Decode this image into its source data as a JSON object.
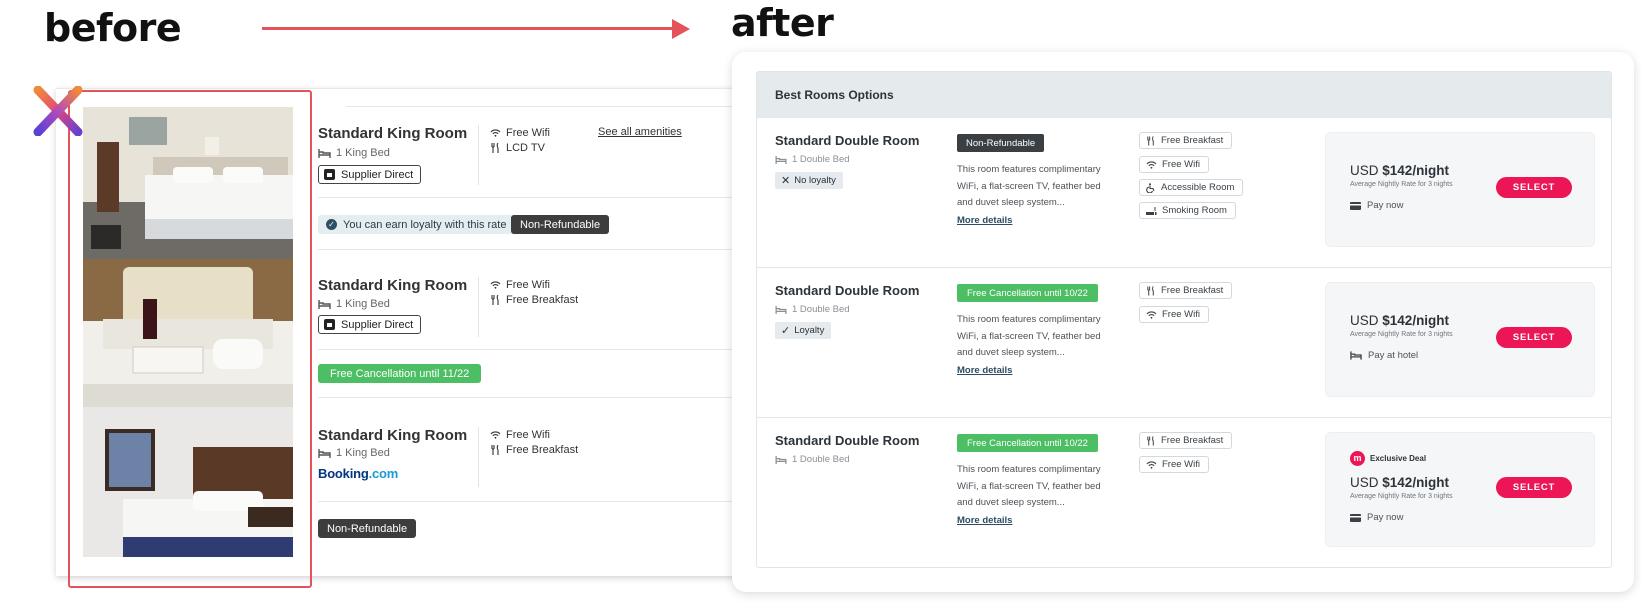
{
  "labels": {
    "before": "before",
    "after": "after"
  },
  "colors": {
    "arrow": "#e5535a",
    "select": "#ec1556",
    "green": "#4cbe63",
    "dark_pill": "#3d3d3d"
  },
  "before": {
    "rooms": [
      {
        "title": "Standard King Room",
        "bed": "1 King Bed",
        "supplier": "Supplier Direct",
        "amenities": [
          "Free Wifi",
          "LCD TV"
        ],
        "amenity_icons": [
          "wifi-icon",
          "tv-icon"
        ],
        "see_all": "See all amenities",
        "loyalty": "You can earn loyalty with this rate",
        "status": "Non-Refundable"
      },
      {
        "title": "Standard King Room",
        "bed": "1 King Bed",
        "supplier": "Supplier Direct",
        "amenities": [
          "Free Wifi",
          "Free Breakfast"
        ],
        "amenity_icons": [
          "wifi-icon",
          "cutlery-icon"
        ],
        "status": "Free Cancellation until 11/22"
      },
      {
        "title": "Standard King Room",
        "bed": "1 King Bed",
        "supplier_logo_a": "Booking",
        "supplier_logo_b": ".com",
        "amenities": [
          "Free Wifi",
          "Free Breakfast"
        ],
        "amenity_icons": [
          "wifi-icon",
          "cutlery-icon"
        ],
        "status": "Non-Refundable"
      }
    ]
  },
  "after": {
    "header": "Best Rooms Options",
    "rooms": [
      {
        "title": "Standard Double Room",
        "bed": "1 Double Bed",
        "loyalty": "No loyalty",
        "status": "Non-Refundable",
        "description": "This room features complimentary WiFi, a flat-screen TV, feather bed and duvet sleep system...",
        "more": "More details",
        "amenities": [
          "Free Breakfast",
          "Free Wifi",
          "Accessible Room",
          "Smoking Room"
        ],
        "currency": "USD",
        "price": "$142/night",
        "price_sub": "Average Nightly Rate for 3 nights",
        "pay": "Pay now",
        "select": "SELECT"
      },
      {
        "title": "Standard Double Room",
        "bed": "1 Double Bed",
        "loyalty": "Loyalty",
        "status": "Free Cancellation until 10/22",
        "description": "This room features complimentary WiFi, a flat-screen TV, feather bed and duvet sleep system...",
        "more": "More details",
        "amenities": [
          "Free Breakfast",
          "Free Wifi"
        ],
        "currency": "USD",
        "price": "$142/night",
        "price_sub": "Average Nightly Rate for 3 nights",
        "pay": "Pay at hotel",
        "select": "SELECT"
      },
      {
        "title": "Standard Double Room",
        "bed": "1 Double Bed",
        "status": "Free Cancellation until 10/22",
        "description": "This room features complimentary WiFi, a flat-screen TV, feather bed and duvet sleep system...",
        "more": "More details",
        "amenities": [
          "Free Breakfast",
          "Free Wifi"
        ],
        "deal": "Exclusive Deal",
        "deal_logo": "m",
        "currency": "USD",
        "price": "$142/night",
        "price_sub": "Average Nightly Rate for 3 nights",
        "pay": "Pay now",
        "select": "SELECT"
      }
    ]
  }
}
